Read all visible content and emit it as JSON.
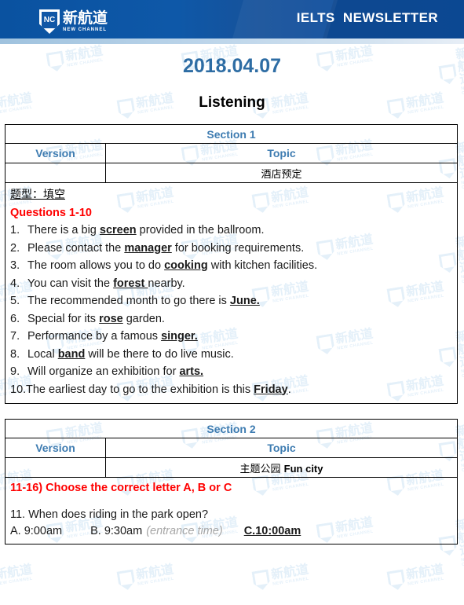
{
  "header": {
    "logo": {
      "cn": "新航道",
      "en": "NEW CHANNEL",
      "mark": "NC"
    },
    "title": "IELTS  NEWSLETTER",
    "brand_color": "#0a52a0"
  },
  "doc": {
    "date": "2018.04.07",
    "title": "Listening",
    "date_color": "#2e6da4",
    "accent_red": "#ff0000",
    "table_head_color": "#3e7cb1"
  },
  "watermark": {
    "cn": "新航道",
    "en": "NEW CHANNEL",
    "color": "#cfe4f5"
  },
  "section1": {
    "heading": "Section 1",
    "col_version": "Version",
    "col_topic": "Topic",
    "version_value": "",
    "topic_value": "酒店预定",
    "question_type": "题型：填空",
    "questions_label": "Questions 1-10",
    "items": [
      {
        "num": "1.",
        "pre": "There is a big ",
        "ans": "screen",
        "post": " provided in the ballroom."
      },
      {
        "num": "2.",
        "pre": "Please contact the ",
        "ans": "manager",
        "post": " for booking requirements."
      },
      {
        "num": "3.",
        "pre": "The room allows you to do ",
        "ans": "cooking",
        "post": " with kitchen facilities."
      },
      {
        "num": "4.",
        "pre": "You can visit the ",
        "ans": "forest ",
        "post": "nearby."
      },
      {
        "num": "5.",
        "pre": "The recommended month to go there is ",
        "ans": "June.",
        "post": ""
      },
      {
        "num": "6.",
        "pre": "Special for its ",
        "ans": "rose",
        "post": " garden."
      },
      {
        "num": "7.",
        "pre": "Performance by a famous ",
        "ans": "singer.",
        "post": ""
      },
      {
        "num": "8.",
        "pre": "Local ",
        "ans": "band",
        "post": " will be there to do live music."
      },
      {
        "num": "9.",
        "pre": "Will organize an exhibition for ",
        "ans": "arts.",
        "post": ""
      },
      {
        "num": "10.",
        "pre": "The earliest day to go to the exhibition is this ",
        "ans": "Friday",
        "post": "."
      }
    ]
  },
  "section2": {
    "heading": "Section 2",
    "col_version": "Version",
    "col_topic": "Topic",
    "version_value": "",
    "topic_cn": "主题公园",
    "topic_en": "Fun city",
    "instruction": "11-16) Choose the correct letter A, B or C",
    "question11": {
      "stem": "11. When does riding in the park open?",
      "option_a": "A. 9:00am",
      "option_b": "B. 9:30am",
      "option_b_note": "(entrance time)",
      "option_c": "C.10:00am"
    }
  }
}
